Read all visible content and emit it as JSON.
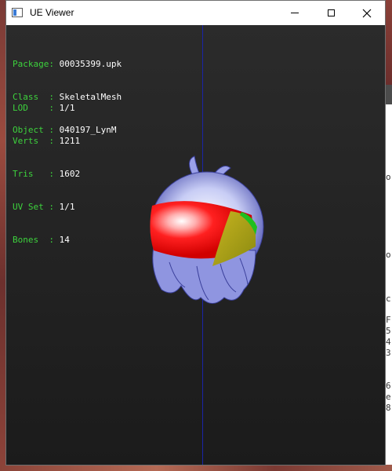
{
  "window": {
    "title": "UE Viewer",
    "icon": "app-window-icon",
    "controls": [
      "minimize-icon",
      "maximize-icon",
      "close-icon"
    ]
  },
  "info_block_1": [
    {
      "label": "Package",
      "value": "00035399.upk"
    },
    {
      "label": "Class  ",
      "value": "SkeletalMesh"
    },
    {
      "label": "Object ",
      "value": "040197_LynM"
    }
  ],
  "info_block_2": [
    {
      "label": "LOD    ",
      "value": "1/1"
    },
    {
      "label": "Verts  ",
      "value": "1211"
    },
    {
      "label": "Tris   ",
      "value": "1602"
    },
    {
      "label": "UV Set ",
      "value": "1/1"
    },
    {
      "label": "Bones  ",
      "value": "14"
    }
  ],
  "background_right_chars": [
    "o",
    "o",
    "c",
    "F",
    "5",
    "4",
    "3",
    "6",
    "e",
    "8"
  ],
  "colors": {
    "label": "#3dd23d",
    "value": "#ffffff",
    "axis": "#1a24a8",
    "viewport_top": "#2b2b2b",
    "viewport_bottom": "#1b1b1b"
  }
}
